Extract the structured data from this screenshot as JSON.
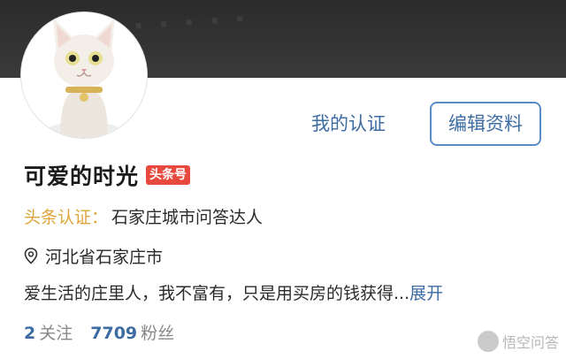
{
  "profile": {
    "name": "可爱的时光",
    "badge": "头条号",
    "cert_label": "头条认证：",
    "cert_text": "石家庄城市问答达人",
    "location": "河北省石家庄市",
    "bio": "爱生活的庄里人，我不富有，只是用买房的钱获得",
    "bio_ellipsis": "...",
    "bio_more": "展开"
  },
  "actions": {
    "verify_label": "我的认证",
    "edit_label": "编辑资料"
  },
  "stats": {
    "following_count": "2",
    "following_label": "关注",
    "followers_count": "7709",
    "followers_label": "粉丝"
  },
  "watermark": {
    "text": "悟空问答"
  },
  "colors": {
    "accent_blue": "#3d6ca3",
    "cert_gold": "#e0a43a",
    "badge_red": "#e8493f",
    "header_dark": "#2b2b2b"
  },
  "icons": {
    "location": "location-pin-icon"
  }
}
